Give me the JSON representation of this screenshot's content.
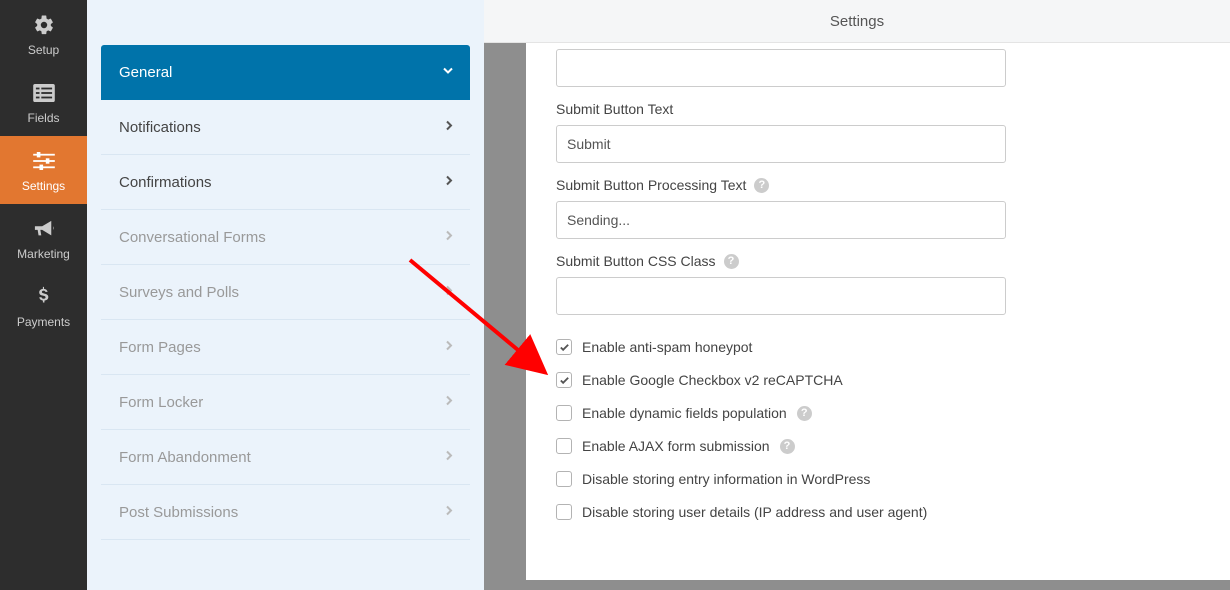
{
  "primarySidebar": {
    "setup": "Setup",
    "fields": "Fields",
    "settings": "Settings",
    "marketing": "Marketing",
    "payments": "Payments"
  },
  "secondarySidebar": {
    "general": "General",
    "notifications": "Notifications",
    "confirmations": "Confirmations",
    "conversationalForms": "Conversational Forms",
    "surveysAndPolls": "Surveys and Polls",
    "formPages": "Form Pages",
    "formLocker": "Form Locker",
    "formAbandonment": "Form Abandonment",
    "postSubmissions": "Post Submissions"
  },
  "header": {
    "title": "Settings"
  },
  "fields": {
    "submitButtonText": {
      "label": "Submit Button Text",
      "value": "Submit"
    },
    "submitButtonProcessingText": {
      "label": "Submit Button Processing Text",
      "value": "Sending..."
    },
    "submitButtonCssClass": {
      "label": "Submit Button CSS Class",
      "value": ""
    }
  },
  "checkboxes": {
    "antiSpam": {
      "label": "Enable anti-spam honeypot",
      "checked": true
    },
    "recaptcha": {
      "label": "Enable Google Checkbox v2 reCAPTCHA",
      "checked": true
    },
    "dynamicFields": {
      "label": "Enable dynamic fields population",
      "checked": false
    },
    "ajax": {
      "label": "Enable AJAX form submission",
      "checked": false
    },
    "disableEntry": {
      "label": "Disable storing entry information in WordPress",
      "checked": false
    },
    "disableUser": {
      "label": "Disable storing user details (IP address and user agent)",
      "checked": false
    }
  }
}
